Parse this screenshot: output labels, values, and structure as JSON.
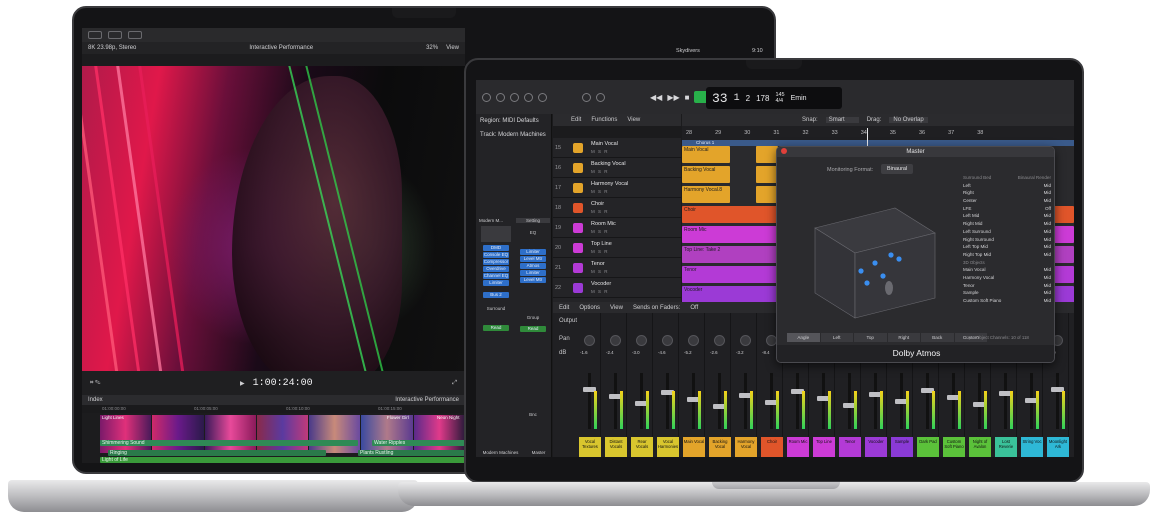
{
  "fcp": {
    "format": "8K 23.98p, Stereo",
    "project": "Interactive Performance",
    "zoom": "32%",
    "view_menu": "View",
    "library": "Skydivers",
    "lib_time": "9:10",
    "timecode": "1:00:24:00",
    "index": "Index",
    "timeline_name": "Interactive Performance",
    "ruler": [
      "01:00:00:00",
      "01:00:05:00",
      "01:00:10:00",
      "01:00:15:00"
    ],
    "clips": {
      "main": "Light Lines",
      "flower": "Flower Girl",
      "neon": "Neon Night",
      "connected": "Light of Life"
    },
    "audio": [
      "Shimmering Sound",
      "Water Ripples",
      "Ringing",
      "Plants Rustling"
    ]
  },
  "logic": {
    "lcd": {
      "bar": "33",
      "beat": "1",
      "div": "2",
      "tick": "178",
      "tempo": "145",
      "sig": "4/4",
      "key": "Emin"
    },
    "inspector": {
      "region": "Region: MIDI Defaults",
      "track": "Track: Modern Machines",
      "channel_name": "Modern M...",
      "setting": "Setting",
      "eq": "EQ",
      "dmd": "DMD",
      "plugins": [
        "Console EQ",
        "Compressor",
        "Overdrive",
        "Channel EQ",
        "Limiter"
      ],
      "plugins_right": [
        "Limiter",
        "Level Mtr",
        "Atmos",
        "Limiter",
        "Level Mtr"
      ],
      "bus": "Bus 2",
      "surround": "Surround",
      "read": "Read",
      "group": "Group",
      "bnc": "Bnc",
      "footer": [
        "Modern Machines",
        "Master"
      ]
    },
    "arrange_menu": [
      "Edit",
      "Functions",
      "View"
    ],
    "snap": {
      "label": "Snap:",
      "value": "Smart"
    },
    "drag": {
      "label": "Drag:",
      "value": "No Overlap"
    },
    "bars": [
      "28",
      "29",
      "30",
      "31",
      "32",
      "33",
      "34",
      "35",
      "36",
      "37",
      "38"
    ],
    "marker": "Chorus 1",
    "tracks": [
      {
        "num": "15",
        "name": "Main Vocal"
      },
      {
        "num": "16",
        "name": "Backing Vocal"
      },
      {
        "num": "17",
        "name": "Harmony Vocal"
      },
      {
        "num": "18",
        "name": "Choir"
      },
      {
        "num": "19",
        "name": "Room Mic"
      },
      {
        "num": "20",
        "name": "Top Line"
      },
      {
        "num": "21",
        "name": "Tenor"
      },
      {
        "num": "22",
        "name": "Vocoder"
      }
    ],
    "msr": "M S R",
    "regions": {
      "main": "Main Vocal",
      "backing": "Backing Vocal",
      "harmony": "Harmony Vocal.8",
      "choir": "Choir",
      "room": "Room Mic",
      "topline": "Top Line: Take 2",
      "tenor": "Tenor",
      "vocoder": "Vocoder"
    },
    "mixer_menu": [
      "Edit",
      "Options",
      "View"
    ],
    "sends": {
      "label": "Sends on Faders:",
      "value": "Off"
    },
    "strip_labels": [
      "Vocal Textures",
      "Distant Vocals",
      "Rear Vocals",
      "Vocal Harmonies",
      "Main Vocal",
      "Backing Vocal",
      "Harmony Vocal",
      "Choir",
      "Room Mic",
      "Top Line",
      "Tenor",
      "Vocoder",
      "Sample",
      "Dark Pad",
      "Custom Soft Piano",
      "Night of Avalon",
      "Lost Reverie",
      "String Voc",
      "Moonlight Ark"
    ],
    "strip_colors": [
      "#d9c62e",
      "#d9c62e",
      "#d9c62e",
      "#d9c62e",
      "#e3a42a",
      "#e3a42a",
      "#e3a42a",
      "#e0552a",
      "#cc3bd6",
      "#cc3bd6",
      "#b33ad6",
      "#9b3ad6",
      "#8a3ad6",
      "#5bc23a",
      "#5bc23a",
      "#5bc23a",
      "#3ac29a",
      "#2eb8d6",
      "#2eb8d6"
    ],
    "output": "Output",
    "pan": "Pan",
    "db": "dB",
    "db_values": [
      "-1.6",
      "-2.4",
      "-3.0",
      "-4.6",
      "-5.2",
      "-2.6",
      "-3.2",
      "-8.4"
    ]
  },
  "atmos": {
    "title": "Master",
    "monitoring_label": "Monitoring Format:",
    "monitoring_value": "Binaural",
    "bed_header": "Surround Bed",
    "render_header": "Binaural Render",
    "bed": [
      [
        "Left",
        "Mid"
      ],
      [
        "Right",
        "Mid"
      ],
      [
        "Center",
        "Mid"
      ],
      [
        "LFE",
        "Off"
      ],
      [
        "Left Mid",
        "Mid"
      ],
      [
        "Right Mid",
        "Mid"
      ],
      [
        "Left Surround",
        "Mid"
      ],
      [
        "Right Surround",
        "Mid"
      ],
      [
        "Left Top Mid",
        "Mid"
      ],
      [
        "Right Top Mid",
        "Mid"
      ]
    ],
    "objects_header": "3D Objects",
    "objects": [
      [
        "Main Vocal",
        "Mid"
      ],
      [
        "Harmony Vocal",
        "Mid"
      ],
      [
        "Tenor",
        "Mid"
      ],
      [
        "Sample",
        "Mid"
      ],
      [
        "Custom Soft Piano",
        "Mid"
      ]
    ],
    "views": [
      "Angle",
      "Left",
      "Top",
      "Right",
      "Back",
      "Custom"
    ],
    "object_channels": "Input Object Channels: 10 of 118",
    "footer": "Dolby Atmos"
  }
}
